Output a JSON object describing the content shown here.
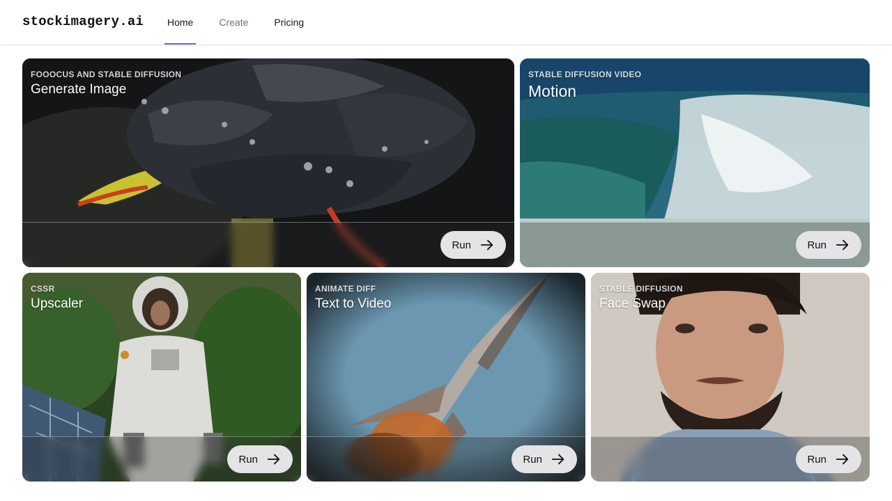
{
  "header": {
    "logo_main": "stockimagery",
    "logo_dot": ".",
    "logo_suffix": "ai",
    "nav": [
      {
        "label": "Home",
        "active": true
      },
      {
        "label": "Create",
        "active": false
      },
      {
        "label": "Pricing",
        "active": false
      }
    ],
    "accent_color": "#6366f1"
  },
  "cards": [
    {
      "kicker": "FOOOCUS AND STABLE DIFFUSION",
      "title": "Generate Image",
      "button": "Run",
      "image": "black-rose-photo"
    },
    {
      "kicker": "STABLE DIFFUSION VIDEO",
      "title": "Motion",
      "button": "Run",
      "image": "ocean-wave-photo"
    },
    {
      "kicker": "CSSR",
      "title": "Upscaler",
      "button": "Run",
      "image": "astronaut-jungle-photo"
    },
    {
      "kicker": "ANIMATE DIFF",
      "title": "Text to Video",
      "button": "Run",
      "image": "rocket-photo"
    },
    {
      "kicker": "STABLE DIFFUSION",
      "title": "Face Swap",
      "button": "Run",
      "image": "portrait-man-photo"
    }
  ]
}
